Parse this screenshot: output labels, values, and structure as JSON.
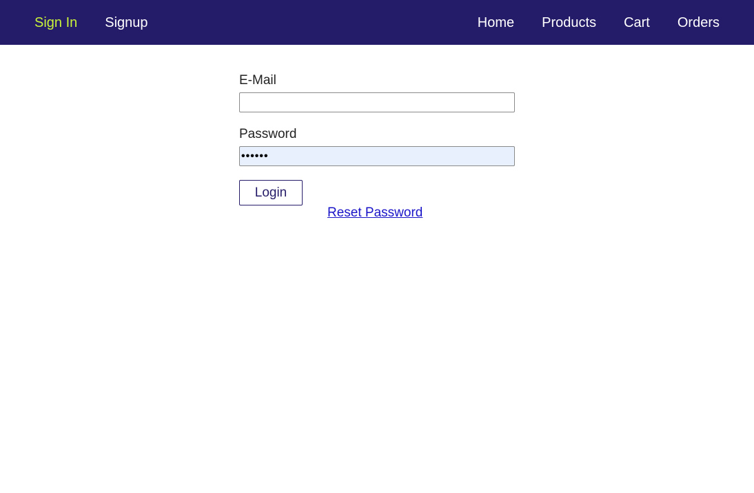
{
  "nav": {
    "left": [
      {
        "label": "Sign In",
        "active": true
      },
      {
        "label": "Signup",
        "active": false
      }
    ],
    "right": [
      {
        "label": "Home"
      },
      {
        "label": "Products"
      },
      {
        "label": "Cart"
      },
      {
        "label": "Orders"
      }
    ]
  },
  "form": {
    "email_label": "E-Mail",
    "email_value": "",
    "password_label": "Password",
    "password_value": "••••••",
    "login_label": "Login",
    "reset_label": "Reset Password"
  },
  "colors": {
    "nav_bg": "#241c68",
    "nav_active": "#c9f23a",
    "link": "#1a14c8",
    "autofill_bg": "#e8f0fe"
  }
}
